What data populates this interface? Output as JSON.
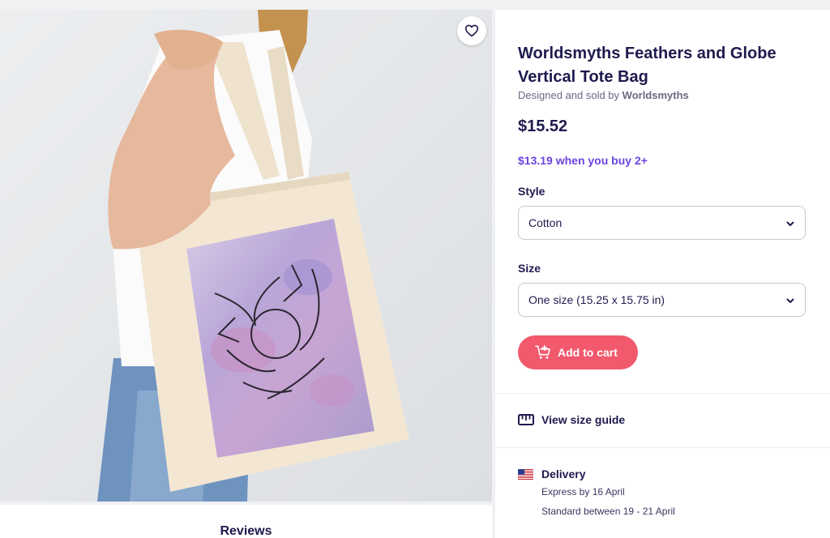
{
  "product": {
    "title": "Worldsmyths Feathers and Globe Vertical Tote Bag",
    "sold_by_prefix": "Designed and sold by ",
    "artist": "Worldsmyths",
    "price": "$15.52",
    "bulk_price": "$13.19 when you buy 2+"
  },
  "style": {
    "label": "Style",
    "value": "Cotton"
  },
  "size": {
    "label": "Size",
    "value": "One size (15.25 x 15.75 in)"
  },
  "cart": {
    "label": "Add to cart"
  },
  "size_guide": {
    "label": "View size guide"
  },
  "delivery": {
    "label": "Delivery",
    "express": "Express by 16 April",
    "standard": "Standard between 19 - 21 April"
  },
  "reviews": {
    "title": "Reviews"
  },
  "icons": {
    "favorite": "heart-icon",
    "select": "chevron-down-icon",
    "cart": "cart-plus-icon",
    "size_guide": "ruler-icon",
    "delivery": "us-flag-icon"
  },
  "colors": {
    "accent": "#f2596c",
    "bulk_price": "#6b45e0",
    "text": "#1e1a4d"
  }
}
